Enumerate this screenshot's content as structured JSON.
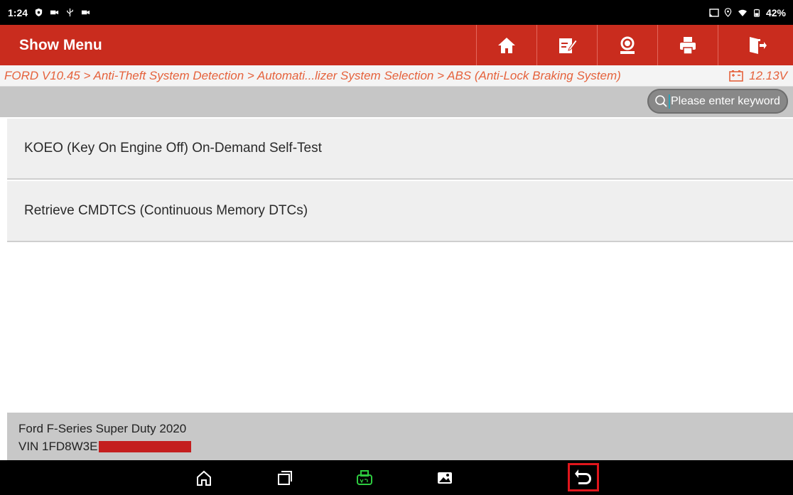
{
  "status_bar": {
    "time": "1:24",
    "battery": "42%"
  },
  "header": {
    "title": "Show Menu",
    "buttons": [
      "home-icon",
      "edit-report-icon",
      "support-icon",
      "print-icon",
      "exit-icon"
    ]
  },
  "breadcrumb": {
    "path": "FORD V10.45 > Anti-Theft System Detection > Automati...lizer System Selection > ABS (Anti-Lock Braking System)",
    "voltage": "12.13V"
  },
  "search": {
    "placeholder": "Please enter keyword"
  },
  "menu": {
    "items": [
      {
        "label": "KOEO (Key On Engine Off) On-Demand Self-Test"
      },
      {
        "label": "Retrieve CMDTCS (Continuous Memory DTCs)"
      }
    ]
  },
  "vehicle": {
    "model": "Ford F-Series Super Duty 2020",
    "vin_prefix": "VIN 1FD8W3E"
  },
  "nav_bar": {
    "buttons": [
      "android-home-icon",
      "recents-icon",
      "vci-icon",
      "screenshot-gallery-icon",
      "back-icon"
    ],
    "highlighted": "back-icon"
  },
  "colors": {
    "header_red": "#c92c1e",
    "breadcrumb_orange": "#e5623c",
    "vci_green": "#2ecc40",
    "highlight_red": "#e0161c"
  }
}
